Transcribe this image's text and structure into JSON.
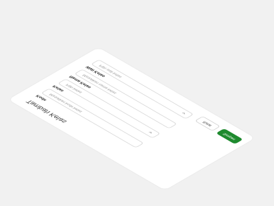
{
  "dialog": {
    "title": "Tambah Kelas",
    "fields": [
      {
        "label": "Kode",
        "placeholder": "Masukkan kode kelas",
        "type": "text"
      },
      {
        "label": "Kelas",
        "placeholder": "Pilih kelas",
        "type": "select"
      },
      {
        "label": "Nama Kelas",
        "placeholder": "Masukkan nama kelas",
        "type": "text"
      },
      {
        "label": "Wali Kelas",
        "placeholder": "Pilih wali kelas",
        "type": "select"
      }
    ],
    "buttons": {
      "cancel_label": "Batal",
      "save_label": "Simpan"
    }
  },
  "colors": {
    "primary": "#1e8a2e",
    "background": "#f1f1f1",
    "card": "#ffffff"
  },
  "icons": {
    "select_chevron": "chevron-down-icon"
  }
}
